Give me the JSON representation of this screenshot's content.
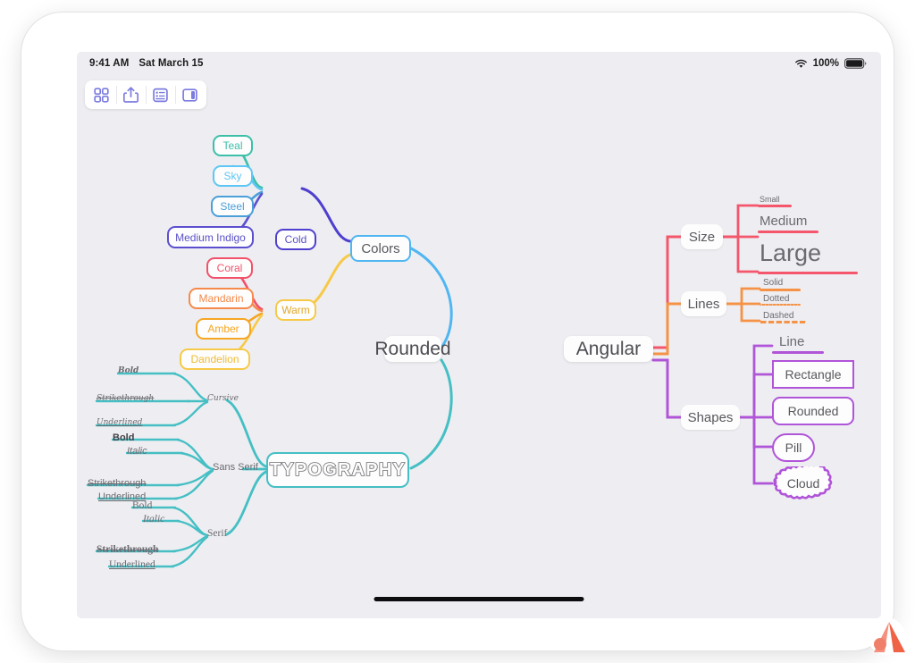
{
  "status_bar": {
    "time": "9:41 AM",
    "date": "Sat March 15",
    "battery_percent": "100%",
    "wifi_icon": "wifi-icon",
    "battery_icon": "battery-icon"
  },
  "toolbar": {
    "buttons": [
      {
        "name": "grid-view-button",
        "icon": "grid-icon"
      },
      {
        "name": "share-button",
        "icon": "share-icon"
      },
      {
        "name": "outline-view-button",
        "icon": "list-icon"
      },
      {
        "name": "sidebar-toggle-button",
        "icon": "sidebar-icon"
      }
    ]
  },
  "mindmap": {
    "roots": [
      {
        "label": "Rounded",
        "style": "curved-connectors"
      },
      {
        "label": "Angular",
        "style": "right-angle-connectors"
      }
    ],
    "colors_branch": {
      "label": "Colors",
      "color": "#4FB6F2",
      "groups": [
        {
          "label": "Cold",
          "color": "#4f3fcf",
          "children": [
            {
              "label": "Teal",
              "color": "#3bbfa8"
            },
            {
              "label": "Sky",
              "color": "#5ec6f5"
            },
            {
              "label": "Steel",
              "color": "#4a9fd8"
            },
            {
              "label": "Medium Indigo",
              "color": "#5b4fcf"
            }
          ]
        },
        {
          "label": "Warm",
          "color": "#f7c948",
          "children": [
            {
              "label": "Coral",
              "color": "#f2516a"
            },
            {
              "label": "Mandarin",
              "color": "#f58a4b"
            },
            {
              "label": "Amber",
              "color": "#f5a623"
            },
            {
              "label": "Dandelion",
              "color": "#f7c948"
            }
          ]
        }
      ]
    },
    "typography_branch": {
      "label": "TYPOGRAPHY",
      "color": "#45bfc4",
      "groups": [
        {
          "label": "Cursive",
          "font": "cursive",
          "children": [
            {
              "label": "Bold",
              "style": "bold"
            },
            {
              "label": "Strikethrough",
              "style": "strikethrough"
            },
            {
              "label": "Underlined",
              "style": "underline"
            }
          ]
        },
        {
          "label": "Sans Serif",
          "font": "sans-serif",
          "children": [
            {
              "label": "Bold",
              "style": "bold"
            },
            {
              "label": "Italic",
              "style": "italic"
            },
            {
              "label": "Strikethrough",
              "style": "strikethrough"
            },
            {
              "label": "Underlined",
              "style": "underline"
            }
          ]
        },
        {
          "label": "Serif",
          "font": "serif",
          "children": [
            {
              "label": "Bold",
              "style": "bold"
            },
            {
              "label": "Italic",
              "style": "italic"
            },
            {
              "label": "Strikethrough",
              "style": "strikethrough"
            },
            {
              "label": "Underlined",
              "style": "underline"
            }
          ]
        }
      ]
    },
    "size_branch": {
      "label": "Size",
      "color": "#f4566b",
      "children": [
        {
          "label": "Small",
          "font_size": "9px"
        },
        {
          "label": "Medium",
          "font_size": "15px"
        },
        {
          "label": "Large",
          "font_size": "27px"
        }
      ]
    },
    "lines_branch": {
      "label": "Lines",
      "color": "#f59245",
      "children": [
        {
          "label": "Solid",
          "line_style": "solid"
        },
        {
          "label": "Dotted",
          "line_style": "dotted"
        },
        {
          "label": "Dashed",
          "line_style": "dashed"
        }
      ]
    },
    "shapes_branch": {
      "label": "Shapes",
      "color": "#b054d8",
      "children": [
        {
          "label": "Line",
          "shape": "line"
        },
        {
          "label": "Rectangle",
          "shape": "rectangle"
        },
        {
          "label": "Rounded",
          "shape": "rounded"
        },
        {
          "label": "Pill",
          "shape": "pill"
        },
        {
          "label": "Cloud",
          "shape": "cloud"
        }
      ]
    }
  }
}
